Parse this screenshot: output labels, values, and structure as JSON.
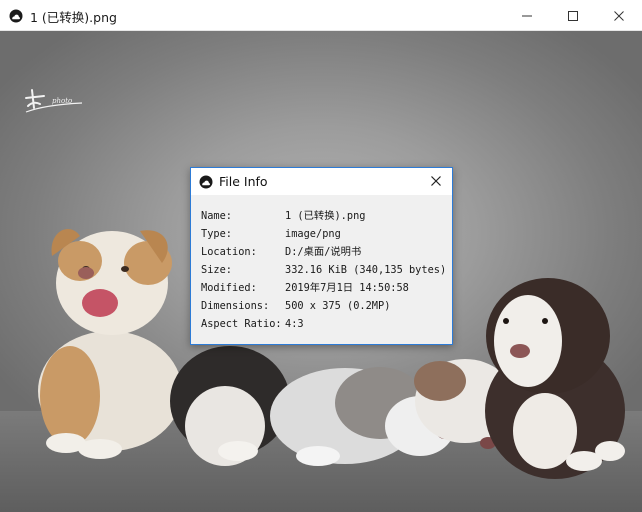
{
  "window": {
    "title": "1 (已转换).png",
    "app_icon": "image-cloud-icon",
    "controls": {
      "minimize": "minimize-icon",
      "maximize": "maximize-icon",
      "close": "close-icon"
    }
  },
  "image": {
    "description_icon": "photo-of-puppies",
    "watermark_text": "photo"
  },
  "dialog": {
    "title": "File Info",
    "close_icon": "close-icon",
    "rows": [
      {
        "label": "Name:",
        "value": "1 (已转换).png"
      },
      {
        "label": "Type:",
        "value": "image/png"
      },
      {
        "label": "Location:",
        "value": "D:/桌面/说明书"
      },
      {
        "label": "Size:",
        "value": "332.16 KiB (340,135 bytes)"
      },
      {
        "label": "Modified:",
        "value": "2019年7月1日 14:50:58"
      },
      {
        "label": "Dimensions:",
        "value": "500 x 375 (0.2MP)"
      },
      {
        "label": "Aspect Ratio:",
        "value": "4:3"
      }
    ]
  }
}
